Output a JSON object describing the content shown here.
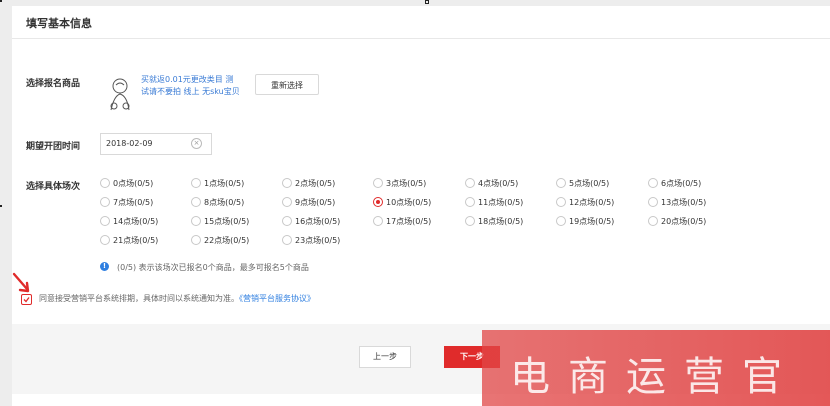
{
  "page": {
    "title": "填写基本信息"
  },
  "form": {
    "product_label": "选择报名商品",
    "product_name": "买就返0.01元更改类目 测试请不要拍 线上 无sku宝贝",
    "reselect_button": "重新选择",
    "date_label": "期望开团时间",
    "date_value": "2018-02-09",
    "session_label": "选择具体场次",
    "sessions": [
      {
        "label": "0点场(0/5)",
        "selected": false
      },
      {
        "label": "1点场(0/5)",
        "selected": false
      },
      {
        "label": "2点场(0/5)",
        "selected": false
      },
      {
        "label": "3点场(0/5)",
        "selected": false
      },
      {
        "label": "4点场(0/5)",
        "selected": false
      },
      {
        "label": "5点场(0/5)",
        "selected": false
      },
      {
        "label": "6点场(0/5)",
        "selected": false
      },
      {
        "label": "7点场(0/5)",
        "selected": false
      },
      {
        "label": "8点场(0/5)",
        "selected": false
      },
      {
        "label": "9点场(0/5)",
        "selected": false
      },
      {
        "label": "10点场(0/5)",
        "selected": true
      },
      {
        "label": "11点场(0/5)",
        "selected": false
      },
      {
        "label": "12点场(0/5)",
        "selected": false
      },
      {
        "label": "13点场(0/5)",
        "selected": false
      },
      {
        "label": "14点场(0/5)",
        "selected": false
      },
      {
        "label": "15点场(0/5)",
        "selected": false
      },
      {
        "label": "16点场(0/5)",
        "selected": false
      },
      {
        "label": "17点场(0/5)",
        "selected": false
      },
      {
        "label": "18点场(0/5)",
        "selected": false
      },
      {
        "label": "19点场(0/5)",
        "selected": false
      },
      {
        "label": "20点场(0/5)",
        "selected": false
      },
      {
        "label": "21点场(0/5)",
        "selected": false
      },
      {
        "label": "22点场(0/5)",
        "selected": false
      },
      {
        "label": "23点场(0/5)",
        "selected": false
      }
    ],
    "info_text": "(0/5) 表示该场次已报名0个商品，最多可报名5个商品",
    "agree_checked": true,
    "agree_text": "同意接受营销平台系统排期，具体时间以系统通知为准。",
    "agree_link": "《营销平台服务协议》"
  },
  "footer": {
    "prev_button": "上一步",
    "next_button": "下一步"
  },
  "watermark": {
    "text": "电商运营官"
  },
  "colors": {
    "accent_red": "#e02b2b",
    "link_blue": "#2f7fe0"
  }
}
